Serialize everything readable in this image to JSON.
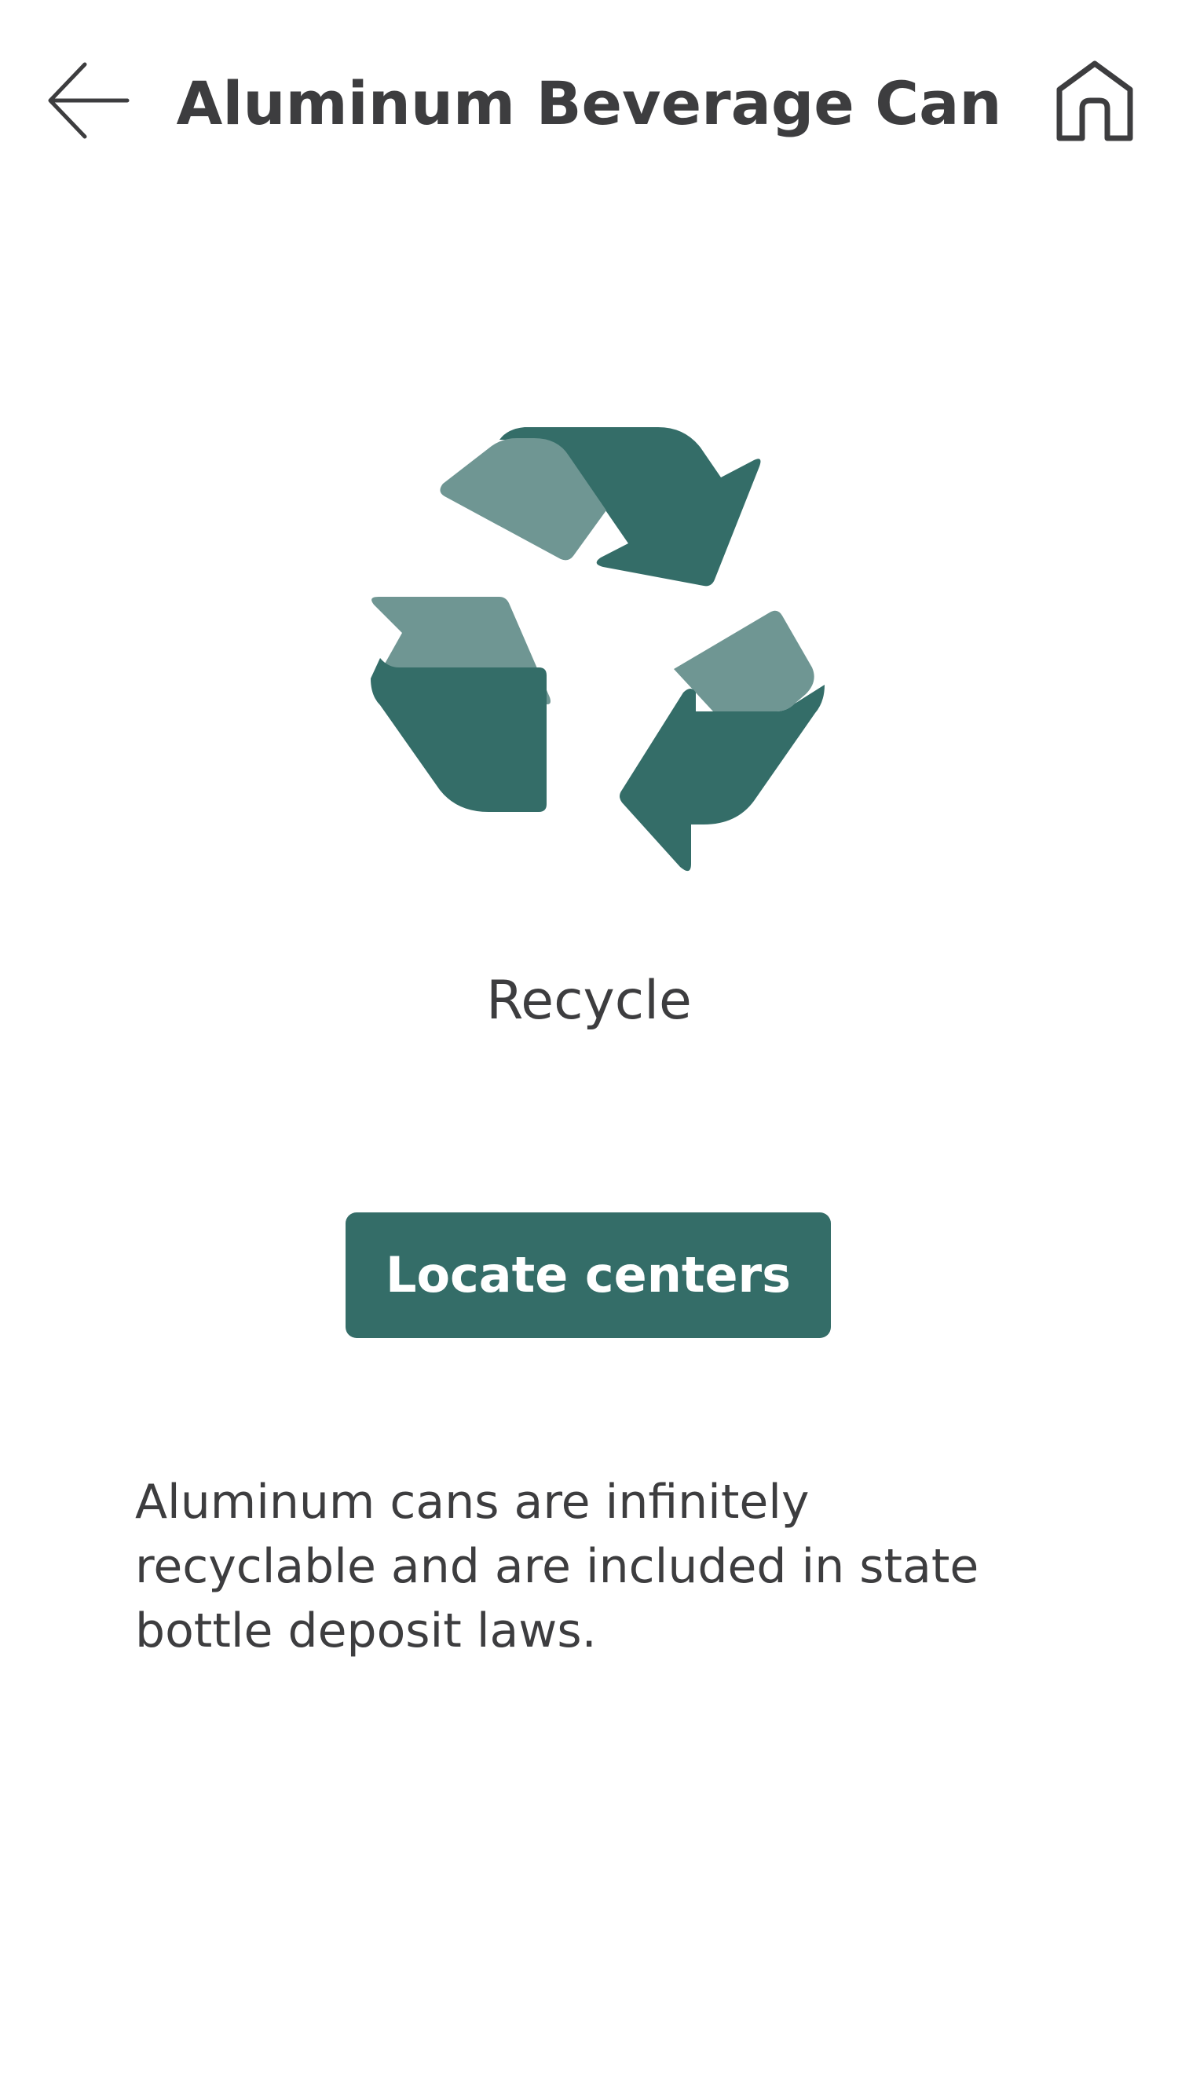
{
  "colors": {
    "accent": "#346d68",
    "accent_light": "#6f9693",
    "text": "#3d3d3f",
    "background": "#ffffff"
  },
  "header": {
    "title": "Aluminum Beverage Can",
    "back_icon": "arrow-left-icon",
    "home_icon": "home-icon"
  },
  "item": {
    "disposal_icon": "recycle-icon",
    "disposal_label": "Recycle",
    "action_label": "Locate centers",
    "description": "Aluminum cans are infinitely recyclable and are included in state bottle deposit laws."
  }
}
